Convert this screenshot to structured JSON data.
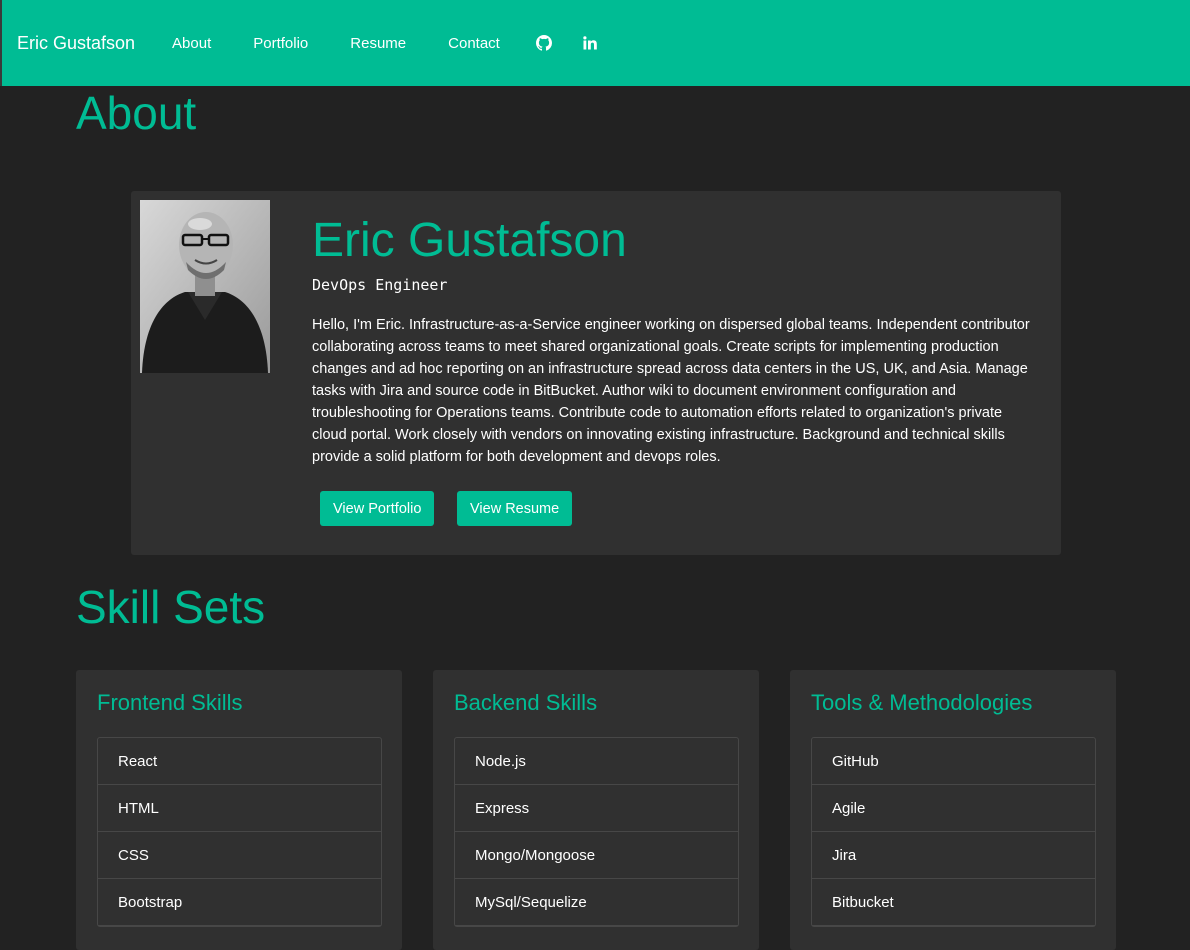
{
  "nav": {
    "brand": "Eric Gustafson",
    "links": [
      "About",
      "Portfolio",
      "Resume",
      "Contact"
    ],
    "icons": [
      "github-icon",
      "linkedin-icon"
    ]
  },
  "about": {
    "heading": "About",
    "name": "Eric Gustafson",
    "role": "DevOps Engineer",
    "bio": "Hello, I'm Eric. Infrastructure-as-a-Service engineer working on dispersed global teams. Independent contributor collaborating across teams to meet shared organizational goals. Create scripts for implementing production changes and ad hoc reporting on an infrastructure spread across data centers in the US, UK, and Asia. Manage tasks with Jira and source code in BitBucket. Author wiki to document environment configuration and troubleshooting for Operations teams. Contribute code to automation efforts related to organization's private cloud portal. Work closely with vendors on innovating existing infrastructure. Background and technical skills provide a solid platform for both development and devops roles.",
    "buttons": [
      "View Portfolio",
      "View Resume"
    ]
  },
  "skills": {
    "heading": "Skill Sets",
    "groups": [
      {
        "title": "Frontend Skills",
        "items": [
          "React",
          "HTML",
          "CSS",
          "Bootstrap"
        ]
      },
      {
        "title": "Backend Skills",
        "items": [
          "Node.js",
          "Express",
          "Mongo/Mongoose",
          "MySql/Sequelize"
        ]
      },
      {
        "title": "Tools & Methodologies",
        "items": [
          "GitHub",
          "Agile",
          "Jira",
          "Bitbucket"
        ]
      }
    ]
  },
  "colors": {
    "accent": "#00bc94",
    "background": "#222222",
    "card": "#303030"
  }
}
